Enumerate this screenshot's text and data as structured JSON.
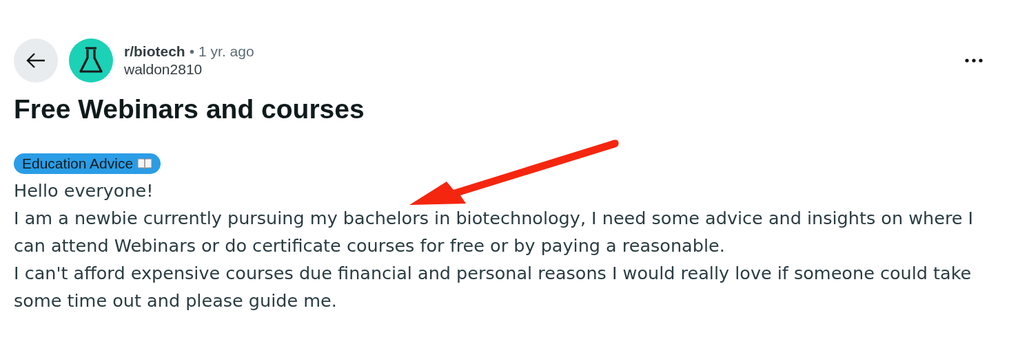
{
  "post": {
    "subreddit": "r/biotech",
    "separator": "•",
    "age": "1 yr. ago",
    "author": "waldon2810",
    "title": "Free Webinars and courses",
    "flair": {
      "label": "Education Advice",
      "color": "#2a9de6"
    },
    "body": [
      "Hello everyone!",
      "I am a newbie currently pursuing my bachelors in biotechnology, I need some advice and insights on where I can attend Webinars or do certificate courses for free or by paying a reasonable.",
      "I can't afford expensive courses due financial and personal reasons I would really love if someone could take some time out and please guide me."
    ]
  }
}
